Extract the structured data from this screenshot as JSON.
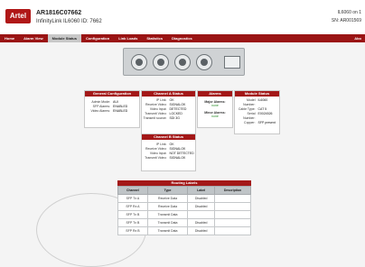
{
  "header": {
    "logo": "Artel",
    "device_name": "AR1816C07662",
    "device_sub": "InfinityLink IL6060   ID: 7662",
    "ip_line": "IL6060 on 1",
    "sn_line": "SN: AR001569"
  },
  "nav": {
    "tabs": [
      "Home",
      "Alarm View",
      "Module Status",
      "Configuration",
      "Link Loads",
      "Statistics",
      "Diagnostics"
    ],
    "active": 2,
    "right_label": "Abo"
  },
  "general_config": {
    "title": "General Configuration",
    "rows": [
      {
        "k": "Admin Mode:",
        "v": "AUI"
      },
      {
        "k": "SFP Alarms:",
        "v": "ENABLED"
      },
      {
        "k": "Video Alarms:",
        "v": "ENABLED"
      }
    ]
  },
  "channel_a": {
    "title": "Channel A Status",
    "rows": [
      {
        "k": "IP Link:",
        "v": "OK"
      },
      {
        "k": "Receive Video:",
        "v": "SIGNALOK"
      },
      {
        "k": "Video Input:",
        "v": "DETECTED"
      },
      {
        "k": "Transmit Video:",
        "v": "LOCKED"
      },
      {
        "k": "Transmit source:",
        "v": "SDI 3G"
      }
    ]
  },
  "alarms": {
    "title": "Alarms",
    "major_label": "Major Alarms:",
    "major_value": "none",
    "minor_label": "Minor Alarms:",
    "minor_value": "none"
  },
  "module_status": {
    "title": "Module Status",
    "rows": [
      {
        "k": "Model Number:",
        "v": "IL6060"
      },
      {
        "k": "Cable Type:",
        "v": "CAT 5"
      },
      {
        "k": "Serial Number:",
        "v": "E0024526"
      },
      {
        "k": "Copper:",
        "v": "SFP present"
      }
    ]
  },
  "channel_b": {
    "title": "Channel B Status",
    "rows": [
      {
        "k": "IP Link:",
        "v": "OK"
      },
      {
        "k": "Receive Video:",
        "v": "SIGNALOK"
      },
      {
        "k": "Video Input:",
        "v": "NOT DETECTED"
      },
      {
        "k": "Transmit Video:",
        "v": "SIGNALOK"
      }
    ]
  },
  "routing": {
    "title": "Routing Labels",
    "headers": [
      "Channel",
      "Type",
      "Label",
      "Description"
    ],
    "rows": [
      [
        "SFP Tx A",
        "Receive Data",
        "Disabled",
        ""
      ],
      [
        "SFP Rx A",
        "Receive Data",
        "Disabled",
        ""
      ],
      [
        "SFP Tx B",
        "Transmit Data",
        "",
        ""
      ],
      [
        "SFP Tx B",
        "Transmit Data",
        "Disabled",
        ""
      ],
      [
        "SFP Rx B",
        "Transmit Data",
        "Disabled",
        ""
      ]
    ]
  }
}
